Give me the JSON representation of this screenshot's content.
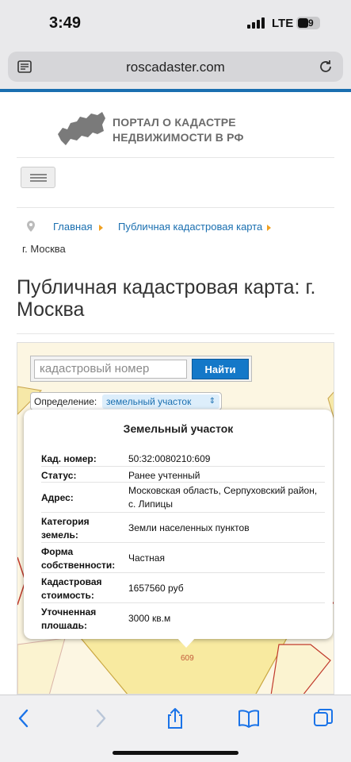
{
  "status": {
    "time": "3:49",
    "network": "LTE",
    "battery": "49"
  },
  "browser": {
    "url": "roscadaster.com"
  },
  "header": {
    "logo_line1": "ПОРТАЛ О КАДАСТРЕ",
    "logo_line2": "НЕДВИЖИМОСТИ В РФ"
  },
  "breadcrumb": {
    "home": "Главная",
    "map": "Публичная кадастровая карта",
    "current": "г. Москва"
  },
  "page": {
    "title": "Публичная кадастровая карта: г. Москва"
  },
  "map": {
    "search_placeholder": "кадастровый номер",
    "search_button": "Найти",
    "definition_label": "Определение:",
    "definition_value": "земельный участок",
    "plot_label": "609",
    "popup": {
      "title": "Земельный участок",
      "rows": [
        {
          "key": "Кад. номер:",
          "value": "50:32:0080210:609"
        },
        {
          "key": "Статус:",
          "value": "Ранее учтенный"
        },
        {
          "key": "Адрес:",
          "value": "Московская область, Серпуховский район, с. Липицы"
        },
        {
          "key": "Категория земель:",
          "value": "Земли населенных пунктов"
        },
        {
          "key": "Форма собственности:",
          "value": "Частная"
        },
        {
          "key": "Кадастровая стоимость:",
          "value": "1657560 руб"
        },
        {
          "key": "Уточненная площадь:",
          "value": "3000 кв.м"
        }
      ]
    }
  }
}
